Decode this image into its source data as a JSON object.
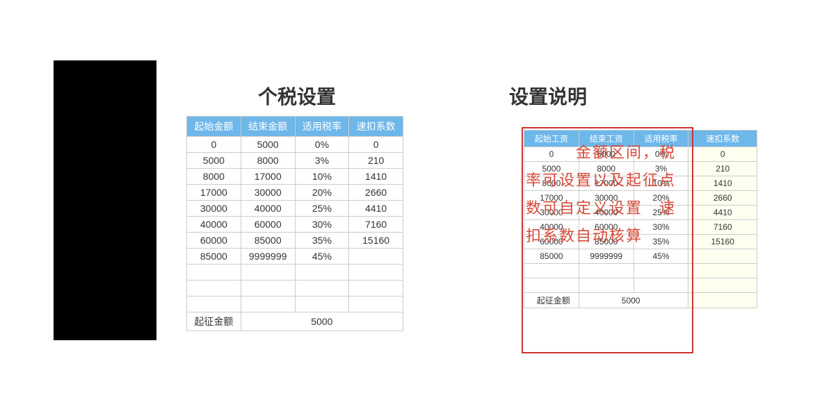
{
  "titles": {
    "tax_settings": "个税设置",
    "description": "设置说明",
    "threshold_label": "起征金额"
  },
  "left_table": {
    "columns": [
      "起始金额",
      "结束金额",
      "适用税率",
      "速扣系数"
    ],
    "rows": [
      [
        "0",
        "5000",
        "0%",
        "0"
      ],
      [
        "5000",
        "8000",
        "3%",
        "210"
      ],
      [
        "8000",
        "17000",
        "10%",
        "1410"
      ],
      [
        "17000",
        "30000",
        "20%",
        "2660"
      ],
      [
        "30000",
        "40000",
        "25%",
        "4410"
      ],
      [
        "40000",
        "60000",
        "30%",
        "7160"
      ],
      [
        "60000",
        "85000",
        "35%",
        "15160"
      ],
      [
        "85000",
        "9999999",
        "45%",
        ""
      ],
      [
        "",
        "",
        "",
        ""
      ],
      [
        "",
        "",
        "",
        ""
      ],
      [
        "",
        "",
        "",
        ""
      ]
    ],
    "threshold_value": "5000"
  },
  "right_table": {
    "columns": [
      "起始工资",
      "结束工资",
      "适用税率",
      "速扣系数"
    ],
    "rows": [
      [
        "0",
        "5000",
        "0%",
        "0"
      ],
      [
        "5000",
        "8000",
        "3%",
        "210"
      ],
      [
        "8000",
        "17000",
        "10%",
        "1410"
      ],
      [
        "17000",
        "30000",
        "20%",
        "2660"
      ],
      [
        "30000",
        "40000",
        "25%",
        "4410"
      ],
      [
        "40000",
        "60000",
        "30%",
        "7160"
      ],
      [
        "60000",
        "85000",
        "35%",
        "15160"
      ],
      [
        "85000",
        "9999999",
        "45%",
        ""
      ],
      [
        "",
        "",
        "",
        ""
      ],
      [
        "",
        "",
        "",
        ""
      ]
    ],
    "threshold_label": "起征金额",
    "threshold_value": "5000"
  },
  "overlay": "　　　金额区间，税率可设置以及起征点数可自定义设置　速扣系数自动核算"
}
